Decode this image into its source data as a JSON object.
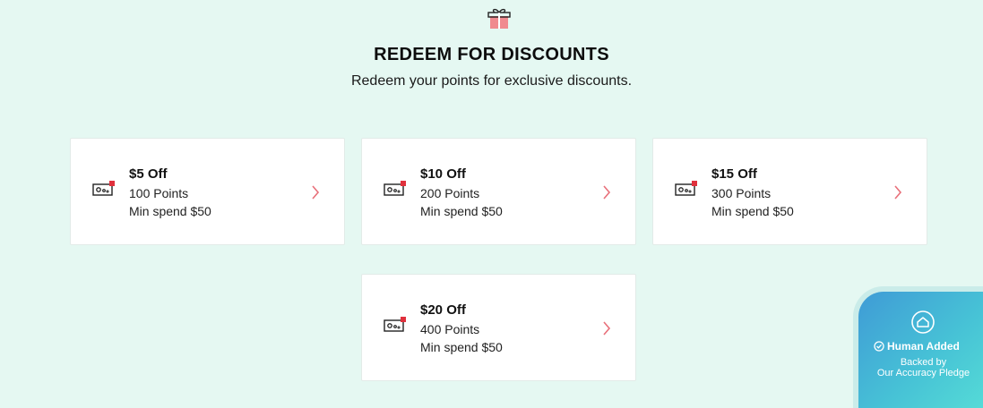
{
  "header": {
    "icon": "gift-icon",
    "title": "REDEEM FOR DISCOUNTS",
    "subtitle": "Redeem your points for exclusive discounts."
  },
  "rewards": [
    {
      "amount": "$5 Off",
      "points": "100 Points",
      "min_spend": "Min spend $50"
    },
    {
      "amount": "$10 Off",
      "points": "200 Points",
      "min_spend": "Min spend $50"
    },
    {
      "amount": "$15 Off",
      "points": "300 Points",
      "min_spend": "Min spend $50"
    },
    {
      "amount": "$20 Off",
      "points": "400 Points",
      "min_spend": "Min spend $50"
    }
  ],
  "badge": {
    "title": "Human Added",
    "line1": "Backed by",
    "line2": "Our Accuracy Pledge"
  },
  "colors": {
    "background": "#e5f8f2",
    "accent": "#e8707a",
    "badge_gradient_start": "#3f9bd6",
    "badge_gradient_end": "#57dfd7"
  }
}
